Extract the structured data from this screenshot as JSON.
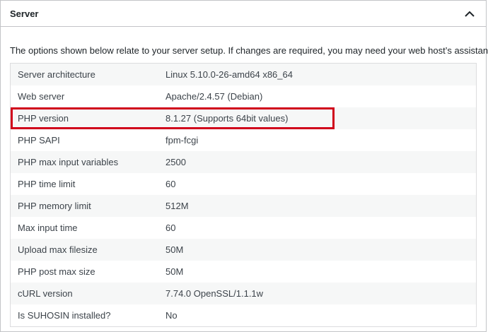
{
  "panel": {
    "title": "Server",
    "toggle_icon": "chevron-up-icon",
    "intro": "The options shown below relate to your server setup. If changes are required, you may need your web host’s assistance."
  },
  "rows": [
    {
      "label": "Server architecture",
      "value": "Linux 5.10.0-26-amd64 x86_64"
    },
    {
      "label": "Web server",
      "value": "Apache/2.4.57 (Debian)"
    },
    {
      "label": "PHP version",
      "value": "8.1.27 (Supports 64bit values)"
    },
    {
      "label": "PHP SAPI",
      "value": "fpm-fcgi"
    },
    {
      "label": "PHP max input variables",
      "value": "2500"
    },
    {
      "label": "PHP time limit",
      "value": "60"
    },
    {
      "label": "PHP memory limit",
      "value": "512M"
    },
    {
      "label": "Max input time",
      "value": "60"
    },
    {
      "label": "Upload max filesize",
      "value": "50M"
    },
    {
      "label": "PHP post max size",
      "value": "50M"
    },
    {
      "label": "cURL version",
      "value": "7.74.0 OpenSSL/1.1.1w"
    },
    {
      "label": "Is SUHOSIN installed?",
      "value": "No"
    }
  ],
  "colors": {
    "highlight": "#d0021b",
    "row_alt": "#f6f7f7",
    "border": "#c3c4c7"
  }
}
